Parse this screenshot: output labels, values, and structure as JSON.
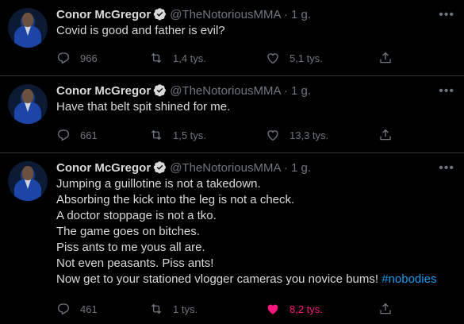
{
  "tweets": [
    {
      "author": "Conor McGregor",
      "handle": "@TheNotoriousMMA",
      "sep": "·",
      "time": "1 g.",
      "lines": [
        "Covid is good and father is evil?"
      ],
      "replies": "966",
      "retweets": "1,4 tys.",
      "likes": "5,1 tys.",
      "liked": false
    },
    {
      "author": "Conor McGregor",
      "handle": "@TheNotoriousMMA",
      "sep": "·",
      "time": "1 g.",
      "lines": [
        "Have that belt spit shined for me."
      ],
      "replies": "661",
      "retweets": "1,5 tys.",
      "likes": "13,3 tys.",
      "liked": false
    },
    {
      "author": "Conor McGregor",
      "handle": "@TheNotoriousMMA",
      "sep": "·",
      "time": "1 g.",
      "lines": [
        "Jumping a guillotine is not a takedown.",
        "Absorbing the kick into the leg is not a check.",
        "A doctor stoppage is not a tko.",
        "The game goes on bitches.",
        "Piss ants to me yous all are.",
        "Not even peasants. Piss ants!",
        "Now get to your stationed vlogger cameras you novice bums!"
      ],
      "hashtag": "#nobodies",
      "replies": "461",
      "retweets": "1 tys.",
      "likes": "8,2 tys.",
      "liked": true
    }
  ],
  "colors": {
    "background": "#000000",
    "muted": "#6e767d",
    "link": "#1d9bf0",
    "like_active": "#f91880",
    "divider": "#2f3336"
  },
  "icons": [
    "verified-badge-icon",
    "more-icon",
    "reply-icon",
    "retweet-icon",
    "like-icon",
    "share-icon"
  ]
}
